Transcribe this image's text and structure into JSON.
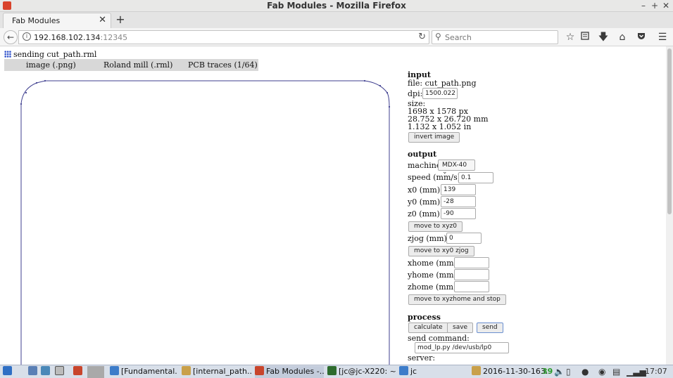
{
  "window": {
    "title": "Fab Modules - Mozilla Firefox",
    "controls": [
      "–",
      "+",
      "✕"
    ]
  },
  "tabs": [
    {
      "label": "Fab Modules",
      "close": "✕"
    }
  ],
  "new_tab": "+",
  "nav": {
    "back": "←",
    "url_host": "192.168.102.134",
    "url_port": ":12345",
    "reload": "↻",
    "search_icon": "🔍",
    "search_placeholder": "Search",
    "toolbar_icons": [
      "star-icon",
      "reading-list-icon",
      "downloads-icon",
      "home-icon",
      "pocket-icon",
      "menu-icon"
    ]
  },
  "page": {
    "status": "sending cut_path.rml",
    "modules": [
      "image (.png)",
      "Roland mill (.rml)",
      "PCB traces (1/64)"
    ]
  },
  "panel": {
    "input": {
      "heading": "input",
      "file": "file: cut_path.png",
      "dpi_label": "dpi:",
      "dpi_value": "1500.022",
      "size_label": "size:",
      "size_px": "1698 x 1578 px",
      "size_mm": "28.752 x 26.720 mm",
      "size_in": "1.132 x 1.052 in",
      "invert_button": "invert image"
    },
    "output": {
      "heading": "output",
      "machine_label": "machine",
      "machine_value": "MDX-40",
      "speed_label": "speed (mm/s):",
      "speed_value": "0.1",
      "x0_label": "x0 (mm):",
      "x0_value": "139",
      "y0_label": "y0 (mm):",
      "y0_value": "-28",
      "z0_label": "z0 (mm):",
      "z0_value": "-90",
      "move_xyz0": "move to xyz0",
      "zjog_label": "zjog (mm):",
      "zjog_value": "0",
      "move_xy0": "move to xy0 zjog",
      "xhome_label": "xhome (mm):",
      "xhome_value": "",
      "yhome_label": "yhome (mm):",
      "yhome_value": "",
      "zhome_label": "zhome (mm):",
      "zhome_value": "",
      "move_home": "move to xyzhome and stop"
    },
    "process": {
      "heading": "process",
      "calculate": "calculate",
      "save": "save",
      "send": "send",
      "send_cmd_label": "send command:",
      "send_cmd_value": "mod_lp.py /dev/usb/lp0",
      "server_label": "server:"
    }
  },
  "taskbar": {
    "items": [
      "[Fundamental...",
      "[internal_path....",
      "Fab Modules -...",
      "[jc@jc-X220: ~]",
      "jc",
      "2016-11-30-163..."
    ],
    "tray_number": "39",
    "clock": "17:07"
  },
  "colors": {
    "toolpath": "#3f3f8f",
    "accent": "#3355cc",
    "taskbar": "#d8dfe9"
  }
}
